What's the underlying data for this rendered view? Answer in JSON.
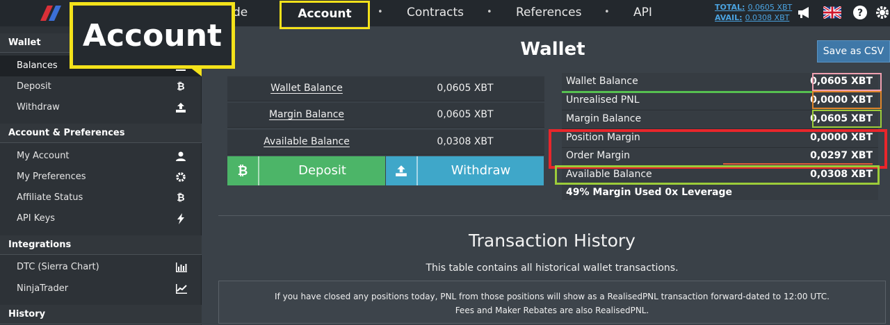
{
  "nav": {
    "trade_partial": "de",
    "account": "Account",
    "contracts": "Contracts",
    "references": "References",
    "api": "API",
    "dot": "•",
    "total_label": "TOTAL:",
    "total_value": "0.0605 XBT",
    "avail_label": "AVAIL:",
    "avail_value": "0.0308 XBT"
  },
  "callout": {
    "text": "Account"
  },
  "sidebar": {
    "wallet_section": "Wallet",
    "balances": "Balances",
    "deposit": "Deposit",
    "withdraw": "Withdraw",
    "account_section": "Account & Preferences",
    "my_account": "My Account",
    "my_preferences": "My Preferences",
    "affiliate_status": "Affiliate Status",
    "api_keys": "API Keys",
    "integrations_section": "Integrations",
    "dtc": "DTC (Sierra Chart)",
    "ninjatrader": "NinjaTrader",
    "history_section": "History"
  },
  "main": {
    "title": "Wallet",
    "save_csv": "Save as CSV",
    "balances": [
      {
        "label": "Wallet Balance",
        "value": "0,0605 XBT"
      },
      {
        "label": "Margin Balance",
        "value": "0,0605 XBT"
      },
      {
        "label": "Available Balance",
        "value": "0,0308 XBT"
      }
    ],
    "deposit_button": "Deposit",
    "withdraw_button": "Withdraw",
    "details": [
      {
        "label": "Wallet Balance",
        "value": "0,0605 XBT"
      },
      {
        "label": "Unrealised PNL",
        "value": "0,0000 XBT"
      },
      {
        "label": "Margin Balance",
        "value": "0,0605 XBT"
      },
      {
        "label": "Position Margin",
        "value": "0,0000 XBT"
      },
      {
        "label": "Order Margin",
        "value": "0,0297 XBT"
      },
      {
        "label": "Available Balance",
        "value": "0,0308 XBT"
      }
    ],
    "margin_used": "49% Margin Used 0x Leverage",
    "tx_title": "Transaction History",
    "tx_subtitle": "This table contains all historical wallet transactions.",
    "notice_line1": "If you have closed any positions today, PNL from those positions will show as a RealisedPNL transaction forward-dated to 12:00 UTC.",
    "notice_line2": "Fees and Maker Rebates are also RealisedPNL."
  },
  "colors": {
    "highlight_yellow": "#f4e21a",
    "deposit_green": "#4cb568",
    "withdraw_blue": "#3fa7c9",
    "highlight_red": "#e8262b",
    "highlight_lime": "#9ccc3a",
    "highlight_orange": "#e0862a",
    "highlight_pink": "#f0a0b0"
  },
  "icons": [
    "logo-icon",
    "megaphone-icon",
    "uk-flag-icon",
    "help-icon",
    "settings-icon",
    "bitcoin-icon",
    "upload-icon",
    "user-icon",
    "gear-icon",
    "bolt-icon",
    "bar-chart-icon",
    "line-chart-icon",
    "bank-icon"
  ]
}
